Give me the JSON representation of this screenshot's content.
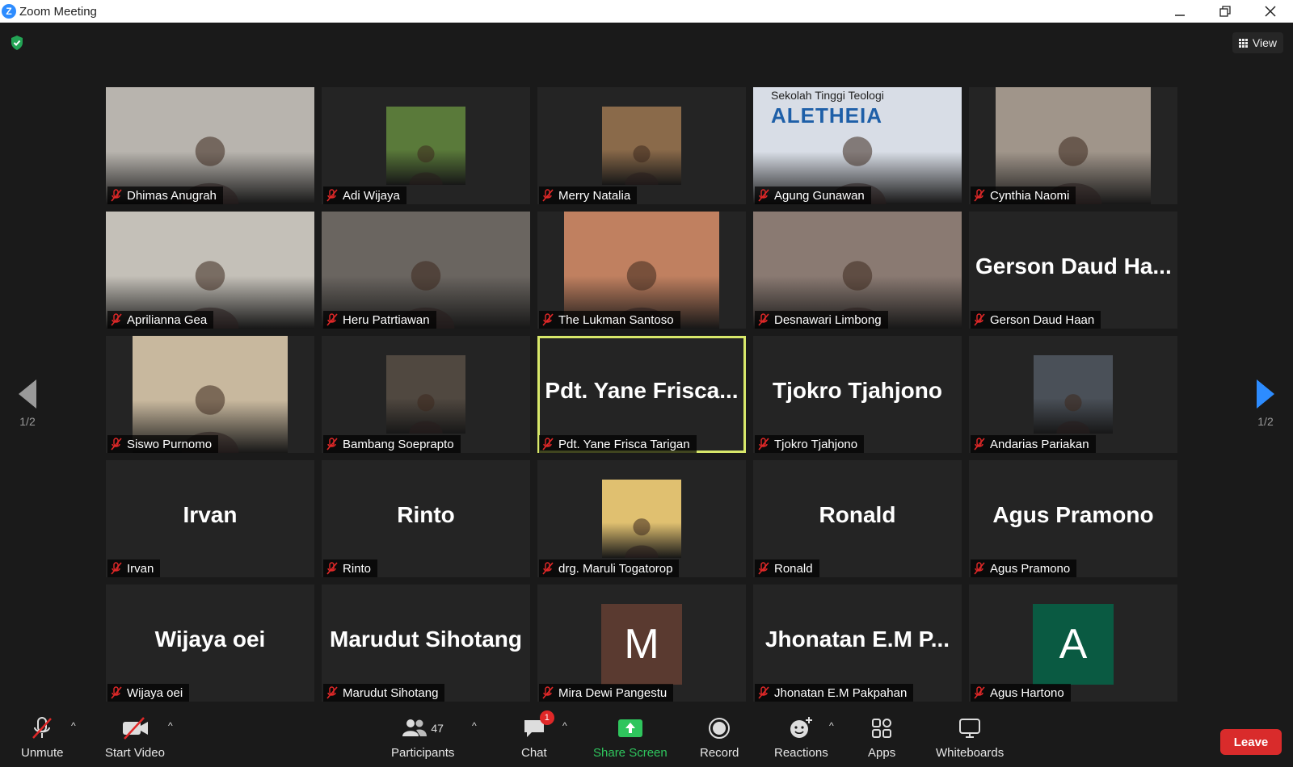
{
  "window": {
    "title": "Zoom Meeting"
  },
  "view_button": "View",
  "page": {
    "indicator": "1/2"
  },
  "tiles": [
    {
      "name": "Dhimas Anugrah",
      "big": "",
      "video": "full",
      "bg": "#b8b4ae"
    },
    {
      "name": "Adi Wijaya",
      "big": "",
      "video": "small",
      "bg": "#5a7a3a"
    },
    {
      "name": "Merry Natalia",
      "big": "",
      "video": "small",
      "bg": "#8a6a4a"
    },
    {
      "name": "Agung Gunawan",
      "big": "",
      "video": "full",
      "bg": "#d8dde6",
      "banner": {
        "line1": "Sekolah Tinggi Teologi",
        "line2": "ALETHEIA"
      }
    },
    {
      "name": "Cynthia Naomi",
      "big": "",
      "video": "center",
      "bg": "#a0958a"
    },
    {
      "name": "Aprilianna Gea",
      "big": "",
      "video": "full",
      "bg": "#c4c0b8"
    },
    {
      "name": "Heru Patrtiawan",
      "big": "",
      "video": "full",
      "bg": "#6a6560"
    },
    {
      "name": "The Lukman Santoso",
      "big": "",
      "video": "center",
      "bg": "#c08060"
    },
    {
      "name": "Desnawari Limbong",
      "big": "",
      "video": "full",
      "bg": "#8a7a72"
    },
    {
      "name": "Gerson Daud Haan",
      "big": "Gerson  Daud  Ha...",
      "video": "none",
      "bg": ""
    },
    {
      "name": "Siswo Purnomo",
      "big": "",
      "video": "center",
      "bg": "#c8b89e"
    },
    {
      "name": "Bambang Soeprapto",
      "big": "",
      "video": "small",
      "bg": "#504840"
    },
    {
      "name": "Pdt. Yane Frisca Tarigan",
      "big": "Pdt.  Yane  Frisca...",
      "video": "none",
      "bg": "",
      "active": true
    },
    {
      "name": "Tjokro Tjahjono",
      "big": "Tjokro Tjahjono",
      "video": "none",
      "bg": ""
    },
    {
      "name": "Andarias Pariakan",
      "big": "",
      "video": "small",
      "bg": "#4a5058"
    },
    {
      "name": "Irvan",
      "big": "Irvan",
      "video": "none",
      "bg": ""
    },
    {
      "name": "Rinto",
      "big": "Rinto",
      "video": "none",
      "bg": ""
    },
    {
      "name": "drg. Maruli Togatorop",
      "big": "",
      "video": "small",
      "bg": "#e0c070"
    },
    {
      "name": "Ronald",
      "big": "Ronald",
      "video": "none",
      "bg": ""
    },
    {
      "name": "Agus Pramono",
      "big": "Agus Pramono",
      "video": "none",
      "bg": ""
    },
    {
      "name": "Wijaya oei",
      "big": "Wijaya oei",
      "video": "none",
      "bg": ""
    },
    {
      "name": "Marudut Sihotang",
      "big": "Marudut Sihotang",
      "video": "none",
      "bg": ""
    },
    {
      "name": "Mira Dewi Pangestu",
      "big": "",
      "video": "letter",
      "letter": "M",
      "bg": "#5a3a30"
    },
    {
      "name": "Jhonatan E.M Pakpahan",
      "big": "Jhonatan  E.M  P...",
      "video": "none",
      "bg": ""
    },
    {
      "name": "Agus Hartono",
      "big": "",
      "video": "letter",
      "letter": "A",
      "bg": "#0a5a42"
    }
  ],
  "toolbar": {
    "unmute": "Unmute",
    "start_video": "Start Video",
    "participants": "Participants",
    "participants_count": "47",
    "chat": "Chat",
    "chat_badge": "1",
    "share_screen": "Share Screen",
    "record": "Record",
    "reactions": "Reactions",
    "apps": "Apps",
    "whiteboards": "Whiteboards",
    "leave": "Leave"
  },
  "colors": {
    "accent_blue": "#2d8cff",
    "share_green": "#2fc55d",
    "leave_red": "#d92b2b",
    "active_border": "#d8e86a",
    "mic_off_red": "#e02828"
  }
}
